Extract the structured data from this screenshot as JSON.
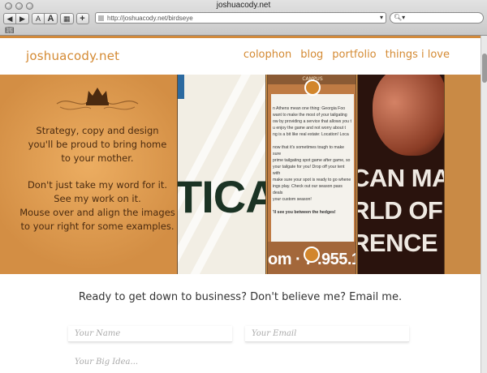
{
  "browser": {
    "window_title": "joshuacody.net",
    "url": "http://joshuacody.net/birdseye",
    "font_small": "A",
    "font_large": "A",
    "add_label": "+",
    "bookmarks_icon": "book-icon"
  },
  "site": {
    "logo": "joshuacody.net",
    "nav": [
      "colophon",
      "blog",
      "portfolio",
      "things i love"
    ]
  },
  "hero": {
    "lines_1": [
      "Strategy, copy and design",
      "you'll be proud to bring home",
      "to your mother."
    ],
    "lines_2": [
      "Don't just take my word for it.",
      "See my work on it.",
      "Mouse over and align the images",
      "to your right for some examples."
    ]
  },
  "contact": {
    "title": "Ready to get down to business? Don't believe me? Email me.",
    "name_placeholder": "Your Name",
    "email_placeholder": "Your Email",
    "idea_placeholder": "Your Big Idea..."
  },
  "colors": {
    "accent": "#d48a33",
    "hero_bg": "#d8984f"
  }
}
